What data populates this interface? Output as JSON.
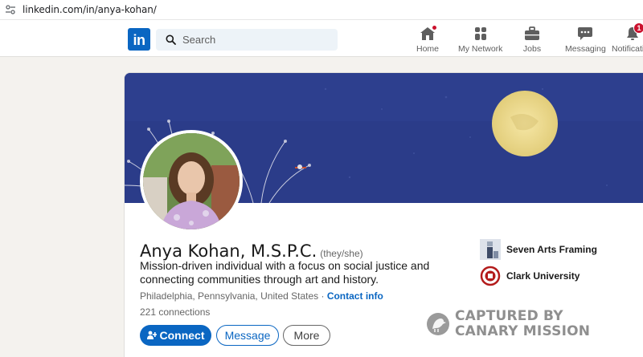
{
  "browser": {
    "url": "linkedin.com/in/anya-kohan/"
  },
  "nav": {
    "logo_text": "in",
    "search_placeholder": "Search",
    "items": [
      {
        "label": "Home",
        "icon": "home-icon",
        "indicator": "dot"
      },
      {
        "label": "My Network",
        "icon": "network-icon"
      },
      {
        "label": "Jobs",
        "icon": "briefcase-icon"
      },
      {
        "label": "Messaging",
        "icon": "message-icon"
      },
      {
        "label": "Notificati",
        "icon": "bell-icon",
        "badge": "1"
      }
    ]
  },
  "profile": {
    "name": "Anya Kohan, M.S.P.C.",
    "pronouns": "(they/she)",
    "headline": "Mission-driven individual with a focus on social justice and connecting communities through art and history.",
    "location": "Philadelphia, Pennsylvania, United States",
    "separator": " · ",
    "contact_info": "Contact info",
    "connections": "221 connections",
    "buttons": {
      "connect": "Connect",
      "message": "Message",
      "more": "More"
    },
    "orgs": [
      {
        "name": "Seven Arts Framing"
      },
      {
        "name": "Clark University"
      }
    ]
  },
  "watermark": {
    "line1": "CAPTURED BY",
    "line2": "CANARY MISSION"
  },
  "colors": {
    "brand": "#0a66c2",
    "banner_sky": "#2d3f8e",
    "moon": "#f0dc8c",
    "notification": "#cb112d"
  }
}
